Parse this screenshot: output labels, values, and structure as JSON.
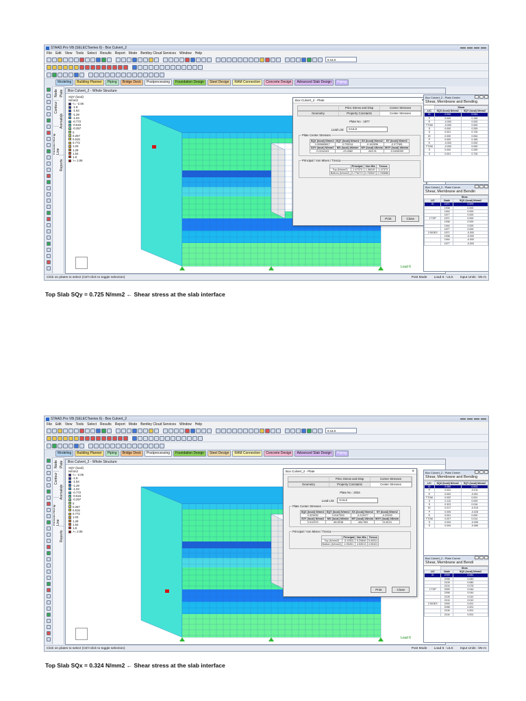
{
  "legend": {
    "title_line1": "SQY (local)",
    "title_line2": "N/mm2",
    "colors": [
      "#2a1a9a",
      "#0e2acc",
      "#1450ee",
      "#1e7ef6",
      "#22aaf6",
      "#22d2ee",
      "#3ae8c8",
      "#6cf29a",
      "#9ef46a",
      "#c8f244",
      "#eaea2a",
      "#f6cc22",
      "#f6a81e",
      "#f27e18",
      "#ea5216",
      "#d82414",
      "#b01010"
    ],
    "values_1": [
      "<= -2.06",
      "-1.8",
      "-1.54",
      "-1.29",
      "-1.03",
      "-0.772",
      "-0.515",
      "-0.257",
      "0",
      "0.257",
      "0.515",
      "0.772",
      "1.03",
      "1.29",
      "1.54",
      "1.8",
      ">= 2.06"
    ],
    "values_2": [
      "<= -2.06",
      "-1.8",
      "-1.54",
      "-1.29",
      "-1.03",
      "-0.772",
      "-0.515",
      "-0.257",
      "0",
      "0.257",
      "0.515",
      "0.772",
      "1.03",
      "1.29",
      "1.54",
      "1.8",
      ">= 2.06"
    ]
  },
  "captions": {
    "caption_1": "Top Slab SQy = 0.725 N/mm2  ← Shear stress at the slab interface",
    "caption_2": "Top Slab SQx = 0.324 N/mm2  ← Shear stress at the slab interface"
  },
  "screen_1": {
    "window_title": "STAAD.Pro V8i (SELECTseries 6) - Box Culvert_2",
    "menu": [
      "File",
      "Edit",
      "View",
      "Tools",
      "Select",
      "Results",
      "Report",
      "Mode",
      "Bentley Cloud Services",
      "Window",
      "Help"
    ],
    "combo_load": "6:ULS",
    "modes": [
      {
        "label": "Modeling",
        "bg": "#b7d7f2"
      },
      {
        "label": "Building Planner",
        "bg": "#f7e08a"
      },
      {
        "label": "Piping",
        "bg": "#b9e8c4"
      },
      {
        "label": "Bridge Deck",
        "bg": "#f6c28a"
      },
      {
        "label": "Postprocessing",
        "bg": "#ffffff"
      },
      {
        "label": "Foundation Design",
        "bg": "#8ed05a"
      },
      {
        "label": "Steel Design",
        "bg": "#f0d9a8"
      },
      {
        "label": "RAM Connection",
        "bg": "#f9f2b2"
      },
      {
        "label": "Concrete Design",
        "bg": "#f4b8d1"
      },
      {
        "label": "Advanced Slab Design",
        "bg": "#d9b8f0"
      },
      {
        "label": "Piping",
        "bg": "#c6b6f6"
      }
    ],
    "side_tabs": {
      "node": "Node",
      "plate": "Plate",
      "contour": "Contour",
      "animation": "Animation",
      "results_along_line": "Results Along Line",
      "reports": "Reports"
    },
    "viewport_title": "Box Culvert_2 - Whole Structure",
    "load_label": "Load 6",
    "status": {
      "left": "Click on plates to select (Ctrl+click to toggle selection)",
      "mode": "Post Mode",
      "load": "Load 6 : ULS",
      "units": "Input Units : kN-m"
    },
    "dialog": {
      "title": "Box Culvert_2 - Plate",
      "tabs_row1": [
        "",
        "Princ Stress and Disp",
        "Corner Stresses"
      ],
      "tabs_row2": [
        "Geometry",
        "Property Constants",
        "Center Stresses"
      ],
      "plate_no": "Plate No : 1877",
      "load_list_label": "Load List:",
      "load_list_value": "6:ULS",
      "center_group": "Plate Center Stresses",
      "h1": [
        "SQX (local) N/mm2",
        "SQY (local) N/mm2",
        "SX (local) N/mm2",
        "SY (local) N/mm2"
      ],
      "r1": [
        "0.000665817",
        "0.725014",
        "-0.162836",
        "-0.377581"
      ],
      "h2": [
        "SXY (local) N/mm2",
        "MX (local) kNm/m",
        "MY (local) kNm/m",
        "MXY (local) kNm/m"
      ],
      "r2": [
        "-0.0244103",
        "-23.4082",
        "-263.01",
        "-0.0496059"
      ],
      "pvm_group": "Principal / Von Mises / Tresca",
      "pvm_header": [
        "",
        "Principal",
        "Von Mis",
        "Tresca"
      ],
      "pvm_rows": [
        [
          "Top (N/mm2)",
          "-1.47373",
          "1.38249",
          "1.47373"
        ],
        [
          "Bottom (N/mm2)",
          "0.776273",
          "0.753547",
          "0.783686"
        ]
      ],
      "print_btn": "Print",
      "close_btn": "Close"
    },
    "panel_top": {
      "title": "Box Culvert_2 - Plate Center",
      "tab": "Shear, Membrane and Bending",
      "group_header": "Shear",
      "headers": [
        "L/C",
        "SQX (local) N/mm2",
        "SQY (local) N/mm2"
      ],
      "rows": [
        [
          "ID",
          "0.000",
          "0.064"
        ],
        [
          "P",
          "0.000",
          "0.165"
        ],
        [
          "E",
          "-0.000",
          "0.000"
        ],
        [
          "TTOM",
          "-0.000",
          "0.000"
        ],
        [
          "S",
          "0.000",
          "0.259"
        ],
        [
          "S",
          "0.001",
          "0.726"
        ],
        [
          "ID",
          "0.000",
          "0.064"
        ],
        [
          "P",
          "0.000",
          "0.165"
        ],
        [
          "E",
          "-0.000",
          "0.000"
        ],
        [
          "TTOM",
          "-0.000",
          "0.000"
        ],
        [
          "S",
          "0.000",
          "0.259"
        ],
        [
          "S",
          "0.001",
          "0.726"
        ]
      ]
    },
    "panel_bottom": {
      "title": "Box Culvert_2 - Plate Corner",
      "tab": "Shear, Membrane and Bendin",
      "group_header": "Shea",
      "headers": [
        "L/C",
        "Node",
        "SQX (local) N/mm2"
      ],
      "rows": [
        [
          "ID",
          "1871",
          "0.000"
        ],
        [
          "",
          "1938",
          "0.000"
        ],
        [
          "",
          "1944",
          "0.000"
        ],
        [
          "",
          "1577",
          "0.000"
        ],
        [
          "2 TOP",
          "1571",
          "0.000"
        ],
        [
          "",
          "1938",
          "0.000"
        ],
        [
          "",
          "1944",
          "0.000"
        ],
        [
          "",
          "1577",
          "0.000"
        ],
        [
          "3 SIDES",
          "1571",
          "-0.000"
        ],
        [
          "",
          "1938",
          "-0.000"
        ],
        [
          "",
          "1944",
          "-0.000"
        ],
        [
          "",
          "1577",
          "-0.000"
        ]
      ]
    }
  },
  "screen_2": {
    "window_title": "STAAD.Pro V8i (SELECTseries 6) - Box Culvert_2",
    "menu": [
      "File",
      "Edit",
      "View",
      "Tools",
      "Select",
      "Results",
      "Report",
      "Mode",
      "Bentley Cloud Services",
      "Window",
      "Help"
    ],
    "combo_load": "6:ULS",
    "modes": [
      {
        "label": "Modeling",
        "bg": "#b7d7f2"
      },
      {
        "label": "Building Planner",
        "bg": "#f7e08a"
      },
      {
        "label": "Piping",
        "bg": "#b9e8c4"
      },
      {
        "label": "Bridge Deck",
        "bg": "#f6c28a"
      },
      {
        "label": "Postprocessing",
        "bg": "#ffffff"
      },
      {
        "label": "Foundation Design",
        "bg": "#8ed05a"
      },
      {
        "label": "Steel Design",
        "bg": "#f0d9a8"
      },
      {
        "label": "RAM Connection",
        "bg": "#f9f2b2"
      },
      {
        "label": "Concrete Design",
        "bg": "#f4b8d1"
      },
      {
        "label": "Advanced Slab Design",
        "bg": "#d9b8f0"
      },
      {
        "label": "Piping",
        "bg": "#c6b6f6"
      }
    ],
    "side_tabs": {
      "node": "Node",
      "plate": "Plate",
      "contour": "Contour",
      "animation": "Animation",
      "results_along_line": "Results Along Line",
      "reports": "Reports"
    },
    "viewport_title": "Box Culvert_2 - Whole Structure",
    "load_label": "Load 6",
    "status": {
      "left": "Click on plates to select (Ctrl+click to toggle selection)",
      "mode": "Post Mode",
      "load": "Load 6 : ULS",
      "units": "Input Units : kN-m"
    },
    "dialog": {
      "title": "Box Culvert_2 - Plate",
      "tabs_row1": [
        "",
        "Princ Stress and Disp",
        "Corner Stresses"
      ],
      "tabs_row2": [
        "Geometry",
        "Property Constants",
        "Center Stresses"
      ],
      "plate_no": "Plate No : 2034",
      "load_list_label": "Load List:",
      "load_list_value": "6:ULS",
      "center_group": "Plate Center Stresses",
      "h1": [
        "SQX (local) N/mm2",
        "SQY (local) N/mm2",
        "SX (local) N/mm2",
        "SY (local) N/mm2"
      ],
      "r1": [
        "0.323935",
        "0.0157393",
        "-0.219077",
        "-0.20933"
      ],
      "h2": [
        "SXY (local) N/mm2",
        "MX (local) kNm/m",
        "MY (local) kNm/m",
        "MXY (local) kNm/m"
      ],
      "r2": [
        "0.012223",
        "-86.8248",
        "-464.963",
        "24.8141"
      ],
      "pvm_group": "Principal / Von Mises / Tresca",
      "pvm_header": [
        "",
        "Principal",
        "Von Mis",
        "Tresca"
      ],
      "pvm_rows": [
        [
          "Top (N/mm2)",
          "-5.40511",
          "5.20846",
          "5.40511"
        ],
        [
          "Bottom (N/mm2)",
          "4.90401",
          "4.53013",
          "4.90401"
        ]
      ],
      "print_btn": "Print",
      "close_btn": "Close"
    },
    "panel_top": {
      "title": "Box Culvert_2 - Plate Center",
      "tab": "Shear, Membrane and Bending",
      "group_header": "",
      "headers": [
        "L/C",
        "SQX (local) N/mm2",
        "SQY (local) N/mm2"
      ],
      "rows": [
        [
          "ID",
          "0.080",
          "0.003"
        ],
        [
          "P",
          "0.031",
          "-0.011"
        ],
        [
          "E",
          "0.002",
          "-0.001"
        ],
        [
          "TTOM",
          "0.002",
          "0.001"
        ],
        [
          "S",
          "0.110",
          "0.009"
        ],
        [
          "S",
          "0.323",
          "0.016"
        ],
        [
          "ID",
          "0.017",
          "-0.015"
        ],
        [
          "P",
          "0.006",
          "-0.028"
        ],
        [
          "E",
          "0.001",
          "0.000"
        ],
        [
          "TTOM",
          "0.007",
          "0.014"
        ],
        [
          "S",
          "0.034",
          "-0.006"
        ],
        [
          "S",
          "0.094",
          "-0.065"
        ]
      ]
    },
    "panel_bottom": {
      "title": "Box Culvert_2 - Plate Corner",
      "tab": "Shear, Membrane and Bendi",
      "group_header": "Shea",
      "headers": [
        "L/C",
        "Node",
        "SQX (local) N/mm2"
      ],
      "rows": [
        [
          "ID",
          "2099",
          "0.081"
        ],
        [
          "",
          "2098",
          "0.083"
        ],
        [
          "",
          "2105",
          "0.080"
        ],
        [
          "",
          "2104",
          "0.078"
        ],
        [
          "2 TOP",
          "2099",
          "0.044"
        ],
        [
          "",
          "2098",
          "0.044"
        ],
        [
          "",
          "2105",
          "0.010"
        ],
        [
          "",
          "2104",
          "0.010"
        ],
        [
          "3 SIDES",
          "2099",
          "0.001"
        ],
        [
          "",
          "2098",
          "0.001"
        ],
        [
          "",
          "2105",
          "0.001"
        ],
        [
          "",
          "2104",
          "0.001"
        ]
      ]
    }
  }
}
